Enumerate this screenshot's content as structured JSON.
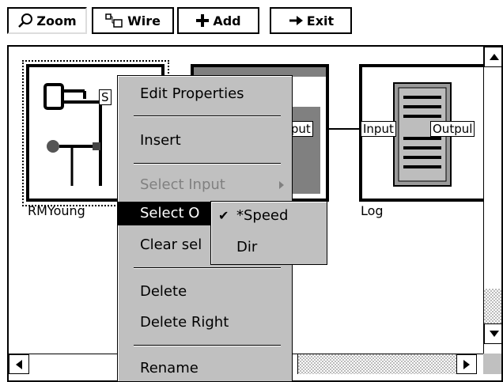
{
  "toolbar": {
    "zoom_label": "Zoom",
    "wire_label": "Wire",
    "add_label": "Add",
    "exit_label": "Exit"
  },
  "blocks": {
    "rmyoung": {
      "label": "RMYoung",
      "port_text": "S"
    },
    "middle": {
      "output_port": "tput"
    },
    "log": {
      "label": "Log",
      "input_port": "Input",
      "output_port": "Outpul"
    }
  },
  "context_menu": {
    "items": [
      {
        "label": "Edit Properties",
        "state": "normal"
      },
      {
        "label": "Insert",
        "state": "normal"
      },
      {
        "label": "Select Input",
        "state": "disabled"
      },
      {
        "label": "Select O",
        "state": "selected"
      },
      {
        "label": "Clear sel",
        "state": "normal"
      },
      {
        "label": "Delete",
        "state": "normal"
      },
      {
        "label": "Delete Right",
        "state": "normal"
      },
      {
        "label": "Rename",
        "state": "normal"
      }
    ]
  },
  "submenu": {
    "items": [
      {
        "label": "*Speed",
        "checked": true
      },
      {
        "label": "Dir",
        "checked": false
      }
    ]
  },
  "colors": {
    "menu_bg": "#c0c0c0",
    "selected_bg": "#000000",
    "disabled_text": "#808080"
  }
}
